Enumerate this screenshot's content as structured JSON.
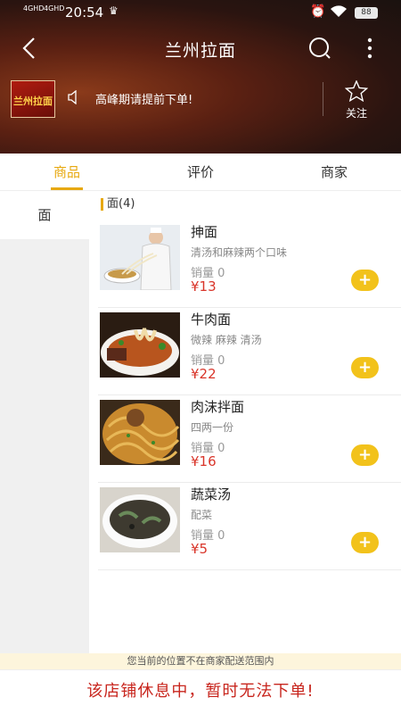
{
  "status_bar": {
    "network_1": "4GHD",
    "network_2": "4GHD",
    "time": "20:54",
    "battery": "88"
  },
  "header": {
    "title": "兰州拉面",
    "shop_logo_text": "兰州拉面",
    "notice": "高峰期请提前下单!",
    "follow_label": "关注"
  },
  "tabs": [
    {
      "label": "商品",
      "active": true
    },
    {
      "label": "评价",
      "active": false
    },
    {
      "label": "商家",
      "active": false
    }
  ],
  "sidebar": {
    "items": [
      {
        "label": "面",
        "active": true
      }
    ]
  },
  "category": {
    "label": "面(4)"
  },
  "items": [
    {
      "name": "抻面",
      "desc": "清汤和麻辣两个口味",
      "sales": "销量 0",
      "price": "¥13",
      "image": "stretched-noodles-chef-photo"
    },
    {
      "name": "牛肉面",
      "desc": "微辣 麻辣  清汤",
      "sales": "销量 0",
      "price": "¥22",
      "image": "beef-noodles-photo"
    },
    {
      "name": "肉沫拌面",
      "desc": "四两一份",
      "sales": "销量 0",
      "price": "¥16",
      "image": "minced-meat-noodles-photo"
    },
    {
      "name": "蔬菜汤",
      "desc": "配菜",
      "sales": "销量 0",
      "price": "¥5",
      "image": "vegetable-soup-photo"
    }
  ],
  "add_button_label": "+",
  "footer": {
    "delivery_notice": "您当前的位置不在商家配送范围内",
    "closed_message": "该店铺休息中，暂时无法下单!"
  },
  "colors": {
    "accent": "#e7a80f",
    "add_button": "#f2c21b",
    "price": "#d9352a",
    "closed_text": "#c8261e"
  }
}
